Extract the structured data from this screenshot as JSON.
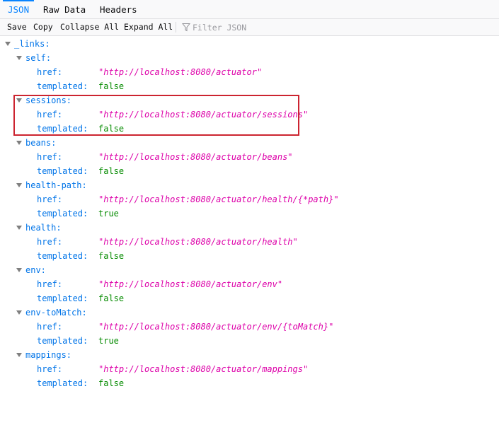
{
  "tabs": [
    {
      "label": "JSON",
      "selected": true
    },
    {
      "label": "Raw Data",
      "selected": false
    },
    {
      "label": "Headers",
      "selected": false
    }
  ],
  "toolbar": {
    "save": "Save",
    "copy": "Copy",
    "collapse_all": "Collapse All",
    "expand_all": "Expand All",
    "filter_placeholder": "Filter JSON",
    "filter_icon": "funnel-icon"
  },
  "colors": {
    "key": "#0074e8",
    "string": "#dd00a9",
    "boolean": "#058b00",
    "highlight": "#cc2430",
    "tab_selected": "#0a84ff"
  },
  "root_key": "_links:",
  "links": [
    {
      "name": "self:",
      "href_label": "href:",
      "href": "\"http://localhost:8080/actuator\"",
      "templated_label": "templated:",
      "templated": "false"
    },
    {
      "name": "sessions:",
      "href_label": "href:",
      "href": "\"http://localhost:8080/actuator/sessions\"",
      "templated_label": "templated:",
      "templated": "false",
      "highlighted": true
    },
    {
      "name": "beans:",
      "href_label": "href:",
      "href": "\"http://localhost:8080/actuator/beans\"",
      "templated_label": "templated:",
      "templated": "false"
    },
    {
      "name": "health-path:",
      "href_label": "href:",
      "href": "\"http://localhost:8080/actuator/health/{*path}\"",
      "templated_label": "templated:",
      "templated": "true"
    },
    {
      "name": "health:",
      "href_label": "href:",
      "href": "\"http://localhost:8080/actuator/health\"",
      "templated_label": "templated:",
      "templated": "false"
    },
    {
      "name": "env:",
      "href_label": "href:",
      "href": "\"http://localhost:8080/actuator/env\"",
      "templated_label": "templated:",
      "templated": "false"
    },
    {
      "name": "env-toMatch:",
      "href_label": "href:",
      "href": "\"http://localhost:8080/actuator/env/{toMatch}\"",
      "templated_label": "templated:",
      "templated": "true"
    },
    {
      "name": "mappings:",
      "href_label": "href:",
      "href": "\"http://localhost:8080/actuator/mappings\"",
      "templated_label": "templated:",
      "templated": "false"
    }
  ]
}
